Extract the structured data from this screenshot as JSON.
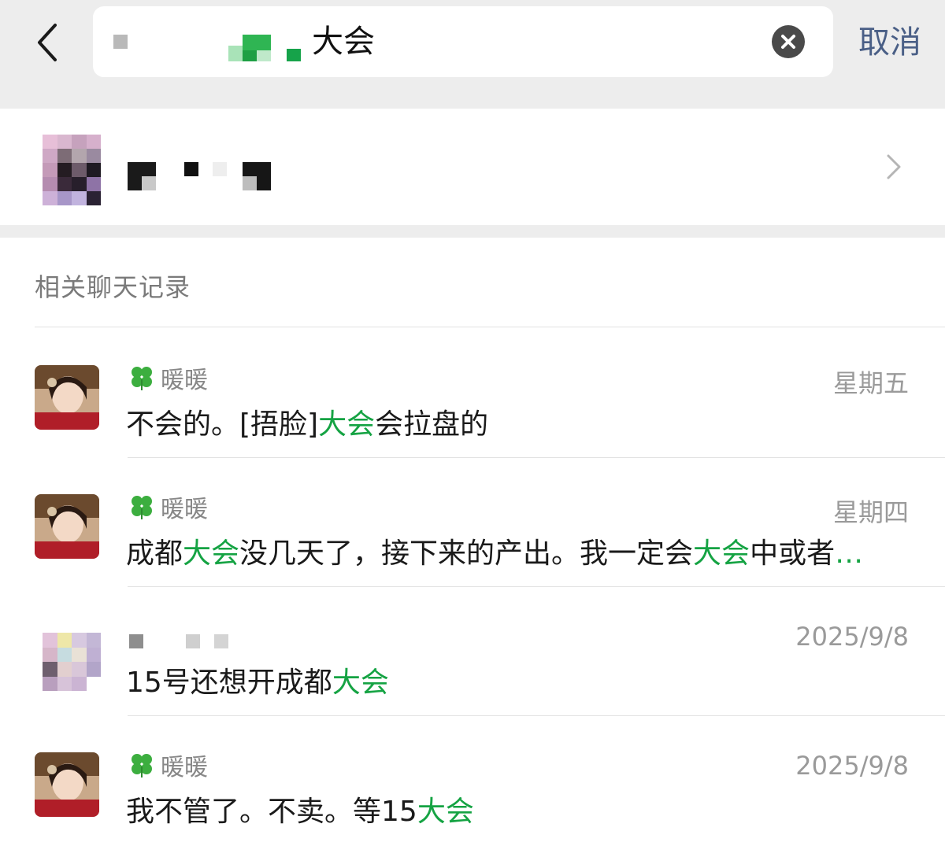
{
  "search": {
    "query": "大会",
    "cancel_label": "取消"
  },
  "section_header": "相关聊天记录",
  "records": [
    {
      "sender": "暖暖",
      "time": "星期五",
      "parts": [
        "不会的。[捂脸]",
        "大会",
        "会拉盘的"
      ]
    },
    {
      "sender": "暖暖",
      "time": "星期四",
      "parts": [
        "成都",
        "大会",
        "没几天了，接下来的产出。我一定会",
        "大会",
        "中或者",
        "…"
      ]
    },
    {
      "sender": "",
      "time": "2025/9/8",
      "parts": [
        "15号还想开成都",
        "大会"
      ]
    },
    {
      "sender": "暖暖",
      "time": "2025/9/8",
      "parts": [
        "我不管了。不卖。等15",
        "大会"
      ]
    }
  ],
  "colors": {
    "highlight": "#15a343",
    "cancel": "#4a5f86",
    "background_gray": "#ededed"
  },
  "icons": {
    "back": "chevron-left-icon",
    "clear": "clear-x-icon",
    "contact_chevron": "chevron-right-icon",
    "clover": "four-leaf-clover-icon"
  }
}
